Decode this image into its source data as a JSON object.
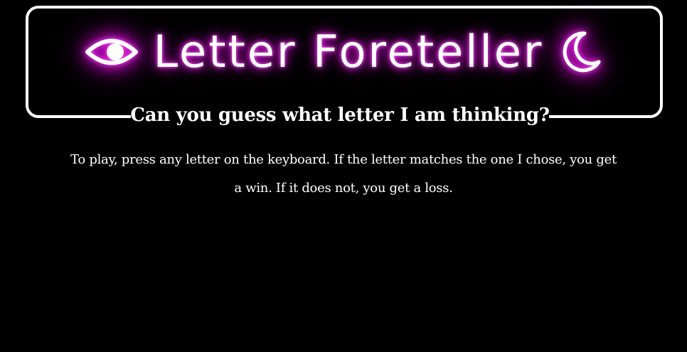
{
  "header": {
    "title": "Letter Foreteller",
    "left_icon": "eye-icon",
    "right_icon": "crescent-moon-icon",
    "glow_color": "#e000e0"
  },
  "subtitle": "Can you guess what letter I am thinking?",
  "instructions": "To play, press any letter on the keyboard. If the letter matches the one I chose, you get a win. If it does not, you get a loss.",
  "colors": {
    "background": "#000000",
    "text": "#ffffff",
    "frame": "#ffffff"
  }
}
